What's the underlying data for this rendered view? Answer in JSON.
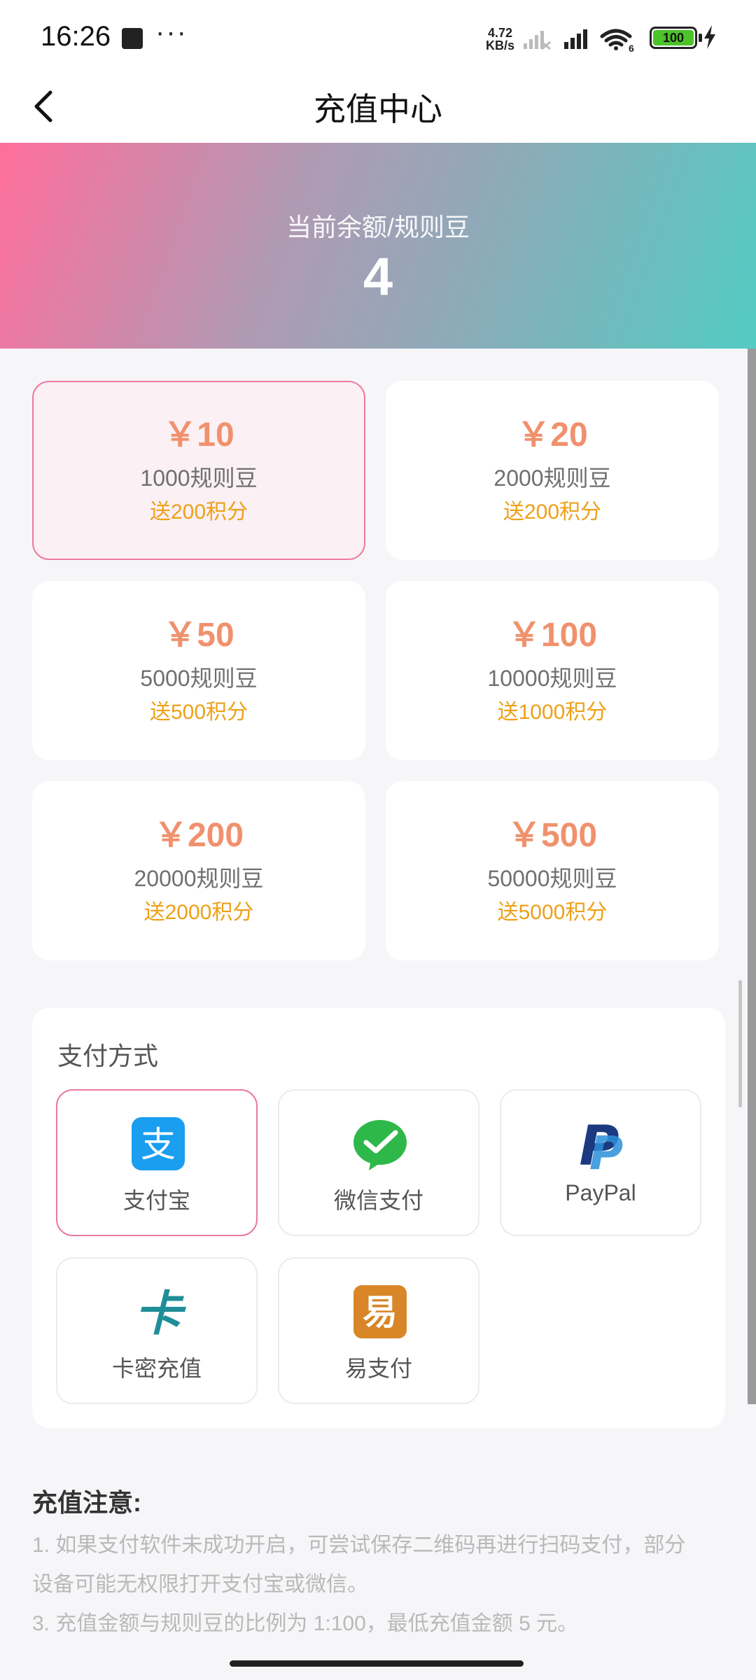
{
  "status_bar": {
    "time": "16:26",
    "net_speed_value": "4.72",
    "net_speed_unit": "KB/s",
    "battery": "100",
    "wifi_badge": "6"
  },
  "nav": {
    "title": "充值中心"
  },
  "balance": {
    "label": "当前余额/规则豆",
    "value": "4"
  },
  "amounts": [
    {
      "price": "￥10",
      "beans": "1000规则豆",
      "bonus": "送200积分",
      "selected": true
    },
    {
      "price": "￥20",
      "beans": "2000规则豆",
      "bonus": "送200积分",
      "selected": false
    },
    {
      "price": "￥50",
      "beans": "5000规则豆",
      "bonus": "送500积分",
      "selected": false
    },
    {
      "price": "￥100",
      "beans": "10000规则豆",
      "bonus": "送1000积分",
      "selected": false
    },
    {
      "price": "￥200",
      "beans": "20000规则豆",
      "bonus": "送2000积分",
      "selected": false
    },
    {
      "price": "￥500",
      "beans": "50000规则豆",
      "bonus": "送5000积分",
      "selected": false
    }
  ],
  "payment": {
    "title": "支付方式",
    "methods": [
      {
        "label": "支付宝",
        "icon": "alipay-icon",
        "selected": true,
        "glyph": "支"
      },
      {
        "label": "微信支付",
        "icon": "wechat-pay-icon",
        "selected": false
      },
      {
        "label": "PayPal",
        "icon": "paypal-icon",
        "selected": false,
        "glyph": "P"
      },
      {
        "label": "卡密充值",
        "icon": "card-code-icon",
        "selected": false,
        "glyph": "卡"
      },
      {
        "label": "易支付",
        "icon": "easy-pay-icon",
        "selected": false,
        "glyph": "易"
      }
    ]
  },
  "notes": {
    "title": "充值注意:",
    "lines": [
      "1. 如果支付软件未成功开启，可尝试保存二维码再进行扫码支付，部分",
      "设备可能无权限打开支付宝或微信。",
      "3. 充值金额与规则豆的比例为 1:100，最低充值金额 5 元。"
    ]
  },
  "colors": {
    "accent_pink": "#ee7aa0",
    "price_orange": "#f0916e",
    "bonus_amber": "#eda018",
    "banner_start": "#ff6e9c",
    "banner_end": "#52cbc2"
  }
}
